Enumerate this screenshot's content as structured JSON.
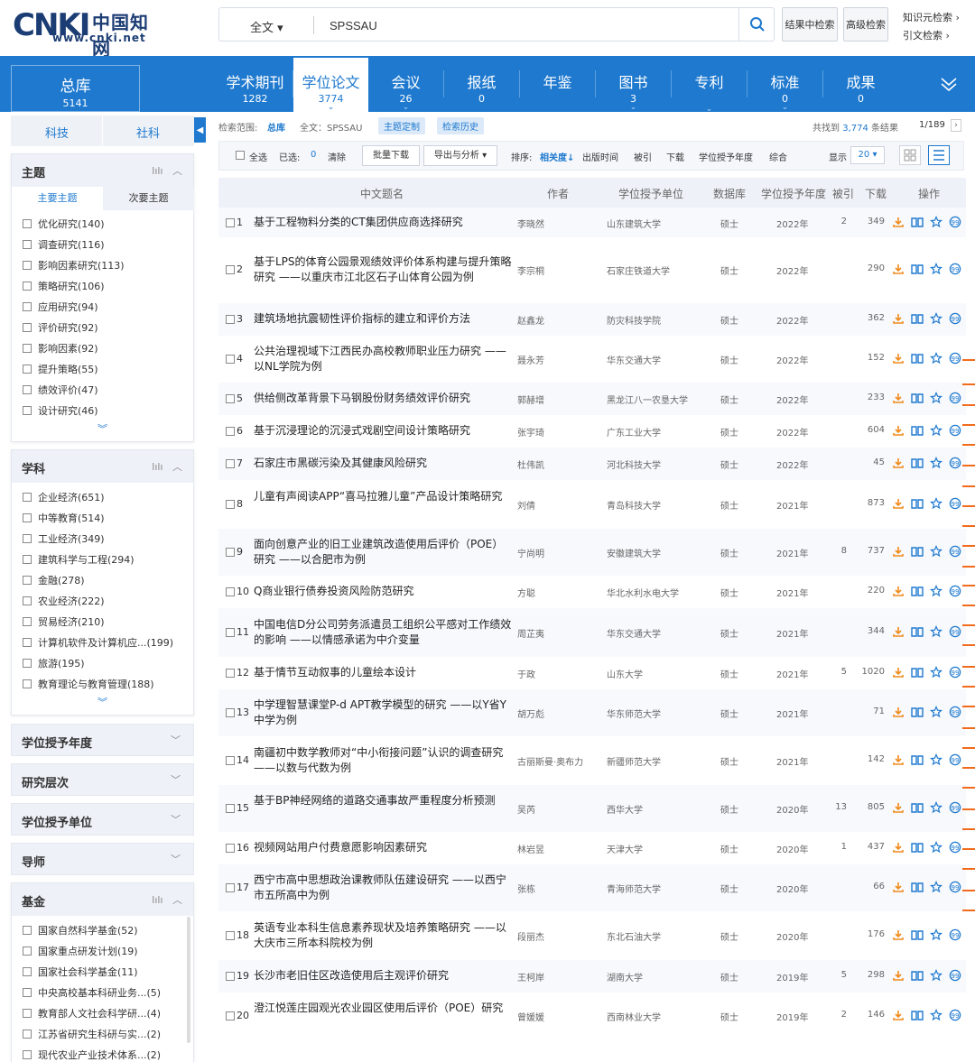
{
  "header": {
    "logo_mark": "CNKI",
    "logo_cn": "中国知网",
    "logo_url": "www.cnki.net",
    "search_scope": "全文",
    "search_value": "SPSSAU",
    "btn_result_search": "结果中检索",
    "btn_advanced": "高级检索",
    "link_knowledge": "知识元检索",
    "link_citation": "引文检索"
  },
  "total": {
    "label": "总库",
    "count": "5141"
  },
  "db_tabs": [
    {
      "label": "学术期刊",
      "count": "1282"
    },
    {
      "label": "学位论文",
      "count": "3774"
    },
    {
      "label": "会议",
      "count": "26"
    },
    {
      "label": "报纸",
      "count": "0"
    },
    {
      "label": "年鉴",
      "count": ""
    },
    {
      "label": "图书",
      "count": "3"
    },
    {
      "label": "专利",
      "count": ""
    },
    {
      "label": "标准",
      "count": "0"
    },
    {
      "label": "成果",
      "count": "0"
    }
  ],
  "sidebar": {
    "tab_science": "科技",
    "tab_social": "社科",
    "topic": {
      "title": "主题",
      "subtab_main": "主要主题",
      "subtab_secondary": "次要主题",
      "items": [
        "优化研究(140)",
        "调查研究(116)",
        "影响因素研究(113)",
        "策略研究(106)",
        "应用研究(94)",
        "评价研究(92)",
        "影响因素(92)",
        "提升策略(55)",
        "绩效评价(47)",
        "设计研究(46)"
      ]
    },
    "discipline": {
      "title": "学科",
      "items": [
        "企业经济(651)",
        "中等教育(514)",
        "工业经济(349)",
        "建筑科学与工程(294)",
        "金融(278)",
        "农业经济(222)",
        "贸易经济(210)",
        "计算机软件及计算机应...(199)",
        "旅游(195)",
        "教育理论与教育管理(188)"
      ]
    },
    "collapsed": [
      "学位授予年度",
      "研究层次",
      "学位授予单位",
      "导师"
    ],
    "fund": {
      "title": "基金",
      "items": [
        "国家自然科学基金(52)",
        "国家重点研发计划(19)",
        "国家社会科学基金(11)",
        "中央高校基本科研业务...(5)",
        "教育部人文社会科学研...(4)",
        "江苏省研究生科研与实...(2)",
        "现代农业产业技术体系...(2)"
      ]
    }
  },
  "crumb": {
    "scope_label": "检索范围:",
    "scope_value": "总库",
    "query": "全文：SPSSAU",
    "btn_topic": "主题定制",
    "btn_history": "检索历史",
    "found_prefix": "共找到",
    "found_count": "3,774",
    "found_suffix": "条结果",
    "page": "1/189"
  },
  "toolbar": {
    "select_all": "全选",
    "selected_label": "已选:",
    "selected_count": "0",
    "clear": "清除",
    "batch_download": "批量下载",
    "export": "导出与分析",
    "sort_label": "排序:",
    "sort_relevance": "相关度",
    "sort_pubtime": "出版时间",
    "sort_cited": "被引",
    "sort_download": "下载",
    "sort_year": "学位授予年度",
    "sort_combined": "综合",
    "show_label": "显示",
    "show_count": "20"
  },
  "table": {
    "headers": [
      "中文题名",
      "作者",
      "学位授予单位",
      "数据库",
      "学位授予年度",
      "被引",
      "下载",
      "操作"
    ],
    "rows": [
      {
        "n": "1",
        "title": "基于工程物料分类的CT集团供应商选择研究",
        "author": "李晓然",
        "unit": "山东建筑大学",
        "db": "硕士",
        "year": "2022年",
        "cite": "2",
        "dl": "349"
      },
      {
        "n": "2",
        "title": "基于LPS的体育公园景观绩效评价体系构建与提升策略研究 ——以重庆市江北区石子山体育公园为例",
        "author": "李宗桐",
        "unit": "石家庄铁道大学",
        "db": "硕士",
        "year": "2022年",
        "cite": "",
        "dl": "290"
      },
      {
        "n": "3",
        "title": "建筑场地抗震韧性评价指标的建立和评价方法",
        "author": "赵鑫龙",
        "unit": "防灾科技学院",
        "db": "硕士",
        "year": "2022年",
        "cite": "",
        "dl": "362"
      },
      {
        "n": "4",
        "title": "公共治理视域下江西民办高校教师职业压力研究 ——以NL学院为例",
        "author": "聂永芳",
        "unit": "华东交通大学",
        "db": "硕士",
        "year": "2022年",
        "cite": "",
        "dl": "152"
      },
      {
        "n": "5",
        "title": "供给侧改革背景下马钢股份财务绩效评价研究",
        "author": "郭赫增",
        "unit": "黑龙江八一农垦大学",
        "db": "硕士",
        "year": "2022年",
        "cite": "",
        "dl": "233"
      },
      {
        "n": "6",
        "title": "基于沉浸理论的沉浸式戏剧空间设计策略研究",
        "author": "张宇琦",
        "unit": "广东工业大学",
        "db": "硕士",
        "year": "2022年",
        "cite": "",
        "dl": "604"
      },
      {
        "n": "7",
        "title": "石家庄市黑碳污染及其健康风险研究",
        "author": "杜伟凯",
        "unit": "河北科技大学",
        "db": "硕士",
        "year": "2022年",
        "cite": "",
        "dl": "45"
      },
      {
        "n": "8",
        "title": "儿童有声阅读APP“喜马拉雅儿童”产品设计策略研究",
        "author": "刘倩",
        "unit": "青岛科技大学",
        "db": "硕士",
        "year": "2021年",
        "cite": "",
        "dl": "873"
      },
      {
        "n": "9",
        "title": "面向创意产业的旧工业建筑改造使用后评价（POE）研究 ——以合肥市为例",
        "author": "宁尚明",
        "unit": "安徽建筑大学",
        "db": "硕士",
        "year": "2021年",
        "cite": "8",
        "dl": "737"
      },
      {
        "n": "10",
        "title": "Q商业银行债券投资风险防范研究",
        "author": "方聪",
        "unit": "华北水利水电大学",
        "db": "硕士",
        "year": "2021年",
        "cite": "",
        "dl": "220"
      },
      {
        "n": "11",
        "title": "中国电信D分公司劳务派遣员工组织公平感对工作绩效的影响 ——以情感承诺为中介变量",
        "author": "周芷夷",
        "unit": "华东交通大学",
        "db": "硕士",
        "year": "2021年",
        "cite": "",
        "dl": "344"
      },
      {
        "n": "12",
        "title": "基于情节互动叙事的儿童绘本设计",
        "author": "于政",
        "unit": "山东大学",
        "db": "硕士",
        "year": "2021年",
        "cite": "5",
        "dl": "1020"
      },
      {
        "n": "13",
        "title": "中学理智慧课堂P-d APT教学模型的研究 ——以Y省Y中学为例",
        "author": "胡万彪",
        "unit": "华东师范大学",
        "db": "硕士",
        "year": "2021年",
        "cite": "",
        "dl": "71"
      },
      {
        "n": "14",
        "title": "南疆初中数学教师对“中小衔接问题”认识的调查研究 ——以数与代数为例",
        "author": "古丽斯曼·奥布力",
        "unit": "新疆师范大学",
        "db": "硕士",
        "year": "2021年",
        "cite": "",
        "dl": "142"
      },
      {
        "n": "15",
        "title": "基于BP神经网络的道路交通事故严重程度分析预测",
        "author": "吴芮",
        "unit": "西华大学",
        "db": "硕士",
        "year": "2020年",
        "cite": "13",
        "dl": "805"
      },
      {
        "n": "16",
        "title": "视频网站用户付费意愿影响因素研究",
        "author": "林岩昱",
        "unit": "天津大学",
        "db": "硕士",
        "year": "2020年",
        "cite": "1",
        "dl": "437"
      },
      {
        "n": "17",
        "title": "西宁市高中思想政治课教师队伍建设研究 ——以西宁市五所高中为例",
        "author": "张栋",
        "unit": "青海师范大学",
        "db": "硕士",
        "year": "2020年",
        "cite": "",
        "dl": "66"
      },
      {
        "n": "18",
        "title": "英语专业本科生信息素养现状及培养策略研究 ——以大庆市三所本科院校为例",
        "author": "段丽杰",
        "unit": "东北石油大学",
        "db": "硕士",
        "year": "2020年",
        "cite": "",
        "dl": "176"
      },
      {
        "n": "19",
        "title": "长沙市老旧住区改造使用后主观评价研究",
        "author": "王柯岸",
        "unit": "湖南大学",
        "db": "硕士",
        "year": "2019年",
        "cite": "5",
        "dl": "298"
      },
      {
        "n": "20",
        "title": "澄江悦莲庄园观光农业园区使用后评价（POE）研究",
        "author": "曾媛媛",
        "unit": "西南林业大学",
        "db": "硕士",
        "year": "2019年",
        "cite": "2",
        "dl": "146"
      }
    ]
  },
  "colors": {
    "brand_blue": "#1e79cf",
    "accent_orange": "#f08a1c",
    "header_navy": "#1c3d74"
  },
  "icons": [
    "search-icon",
    "download-icon",
    "read-icon",
    "favorite-icon",
    "quote-icon",
    "chevron-down-icon",
    "chart-icon",
    "grid-view-icon",
    "list-view-icon"
  ]
}
